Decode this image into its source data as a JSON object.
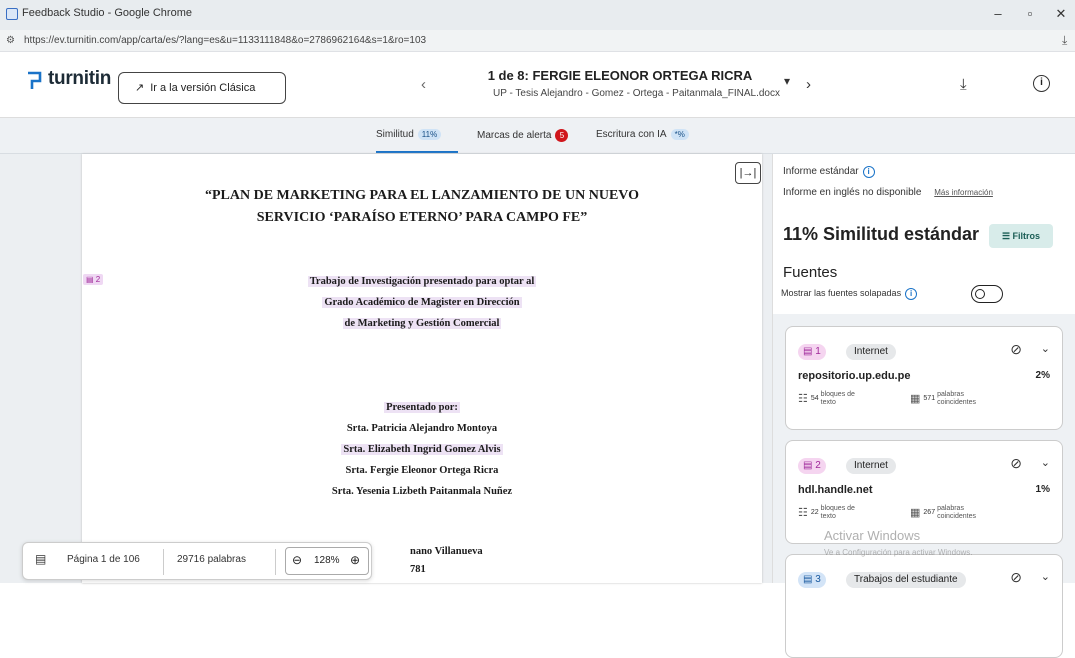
{
  "window": {
    "title": "Feedback Studio - Google Chrome",
    "url": "https://ev.turnitin.com/app/carta/es/?lang=es&u=1133111848&o=2786962164&s=1&ro=103"
  },
  "header": {
    "logo": "turnitin",
    "classic_button": "Ir a la versión Clásica",
    "doc_title": "1 de 8: FERGIE ELEONOR ORTEGA RICRA",
    "doc_subtitle": "UP - Tesis Alejandro - Gomez - Ortega - Paitanmala_FINAL.docx"
  },
  "tabs": [
    {
      "label": "Similitud",
      "badge": "11%"
    },
    {
      "label": "Marcas de alerta",
      "badge": "5"
    },
    {
      "label": "Escritura con IA",
      "badge": "*%"
    }
  ],
  "document": {
    "title_line1": "“PLAN DE MARKETING PARA EL LANZAMIENTO DE UN NUEVO",
    "title_line2": "SERVICIO ‘PARAÍSO ETERNO’ PARA CAMPO FE”",
    "match_flag": "2",
    "sub_lines": [
      "Trabajo de Investigación presentado para optar al",
      "Grado Académico de Magister en Dirección",
      "de Marketing y Gestión Comercial"
    ],
    "presented_by": "Presentado por:",
    "authors": [
      "Srta. Patricia Alejandro Montoya",
      "Srta. Elizabeth Ingrid Gomez Alvis",
      "Srta. Fergie Eleonor Ortega Ricra",
      "Srta. Yesenia Lizbeth Paitanmala Nuñez"
    ],
    "partial_line1": "nano Villanueva",
    "partial_line2": "781"
  },
  "bottombar": {
    "page": "Página 1 de 106",
    "words": "29716 palabras",
    "zoom": "128%"
  },
  "sidepanel": {
    "report_title": "Informe estándar",
    "report_sub": "Informe en inglés no disponible",
    "more_info": "Más información",
    "similarity_title": "11% Similitud estándar",
    "filter_label": "Filtros",
    "sources_heading": "Fuentes",
    "overlap_label": "Mostrar las fuentes solapadas",
    "sources": [
      {
        "num": "1",
        "category": "Internet",
        "domain": "repositorio.up.edu.pe",
        "pct": "2%",
        "blocks": "54",
        "blocks_label": "bloques de texto",
        "words": "571",
        "words_label": "palabras coincidentes"
      },
      {
        "num": "2",
        "category": "Internet",
        "domain": "hdl.handle.net",
        "pct": "1%",
        "blocks": "22",
        "blocks_label": "bloques de texto",
        "words": "267",
        "words_label": "palabras coincidentes"
      },
      {
        "num": "3",
        "category": "Trabajos del estudiante"
      }
    ]
  },
  "watermark": {
    "line1": "Activar Windows",
    "line2": "Ve a Configuración para activar Windows."
  },
  "colors": {
    "accent": "#1a73c8",
    "alert": "#d0161c",
    "source_pill": "#f5d5f0"
  }
}
